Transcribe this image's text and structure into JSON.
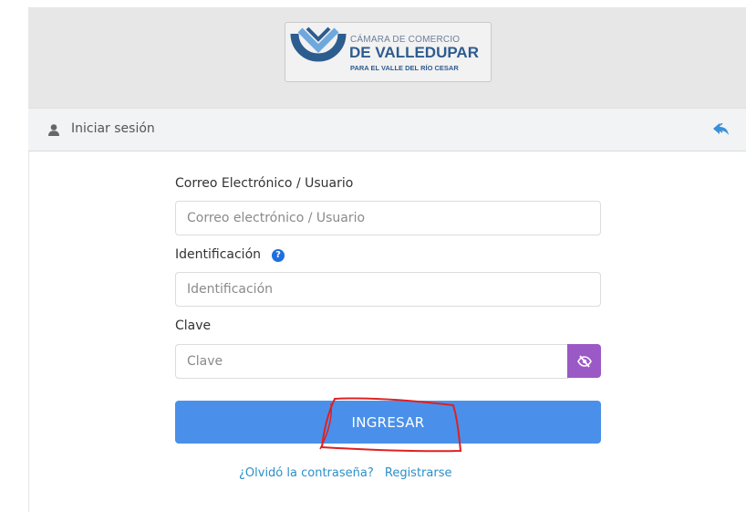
{
  "logo": {
    "line1": "CÁMARA DE COMERCIO",
    "line2": "DE VALLEDUPAR",
    "line3": "PARA EL VALLE DEL RÍO CESAR",
    "colors": {
      "primary": "#2d5c8f",
      "accent": "#6fa8dc"
    }
  },
  "header": {
    "title": "Iniciar sesión",
    "icon": "user-icon",
    "back_icon": "reply-icon"
  },
  "form": {
    "email": {
      "label": "Correo Electrónico / Usuario",
      "placeholder": "Correo electrónico / Usuario",
      "value": ""
    },
    "identification": {
      "label": "Identificación",
      "placeholder": "Identificación",
      "value": "",
      "help_icon": "question-circle-icon"
    },
    "password": {
      "label": "Clave",
      "placeholder": "Clave",
      "value": "",
      "toggle_icon": "eye-slash-icon"
    },
    "submit_label": "INGRESAR"
  },
  "links": {
    "forgot": "¿Olvidó la contraseña?",
    "register": "Registrarse"
  },
  "colors": {
    "submit": "#4a90ea",
    "eye_toggle": "#9b59c5",
    "link": "#2b8fc9",
    "help": "#1e6fe0",
    "annotation": "#e02020"
  }
}
